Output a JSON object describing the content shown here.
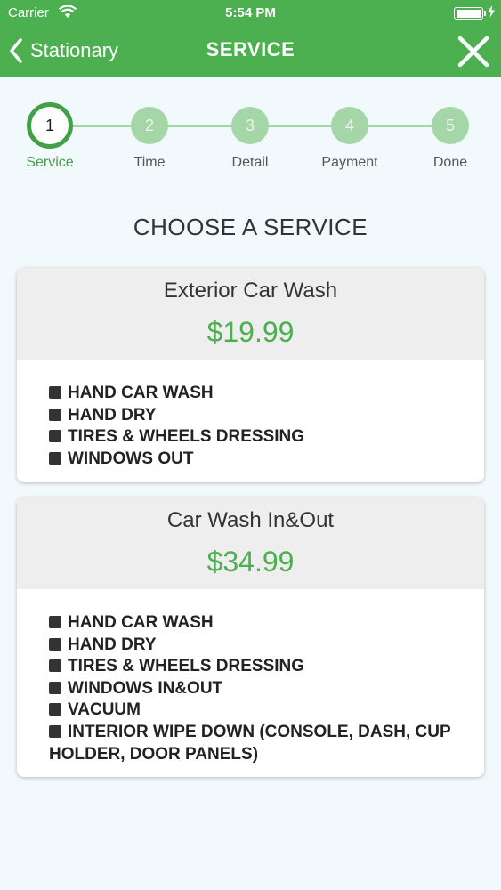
{
  "status_bar": {
    "carrier": "Carrier",
    "time": "5:54 PM"
  },
  "nav": {
    "back_label": "Stationary",
    "title": "SERVICE"
  },
  "stepper": {
    "steps": [
      {
        "number": "1",
        "label": "Service"
      },
      {
        "number": "2",
        "label": "Time"
      },
      {
        "number": "3",
        "label": "Detail"
      },
      {
        "number": "4",
        "label": "Payment"
      },
      {
        "number": "5",
        "label": "Done"
      }
    ],
    "active_index": 0
  },
  "main": {
    "heading": "CHOOSE A SERVICE",
    "services": [
      {
        "name": "Exterior Car Wash",
        "price": "$19.99",
        "features": [
          "HAND CAR WASH",
          "HAND DRY",
          "TIRES & WHEELS DRESSING",
          "WINDOWS OUT"
        ]
      },
      {
        "name": "Car Wash In&Out",
        "price": "$34.99",
        "features": [
          "HAND CAR WASH",
          "HAND DRY",
          "TIRES & WHEELS DRESSING",
          "WINDOWS IN&OUT",
          "VACUUM",
          "INTERIOR WIPE DOWN (CONSOLE, DASH, CUP HOLDER, DOOR PANELS)"
        ]
      }
    ]
  },
  "colors": {
    "brand_green": "#4caf50",
    "step_inactive": "#a5d6a7",
    "background": "#f2f9fc"
  },
  "icons": {
    "wifi": "wifi-icon",
    "battery": "battery-icon",
    "charging": "bolt-icon",
    "back": "chevron-left-icon",
    "close": "close-icon"
  }
}
